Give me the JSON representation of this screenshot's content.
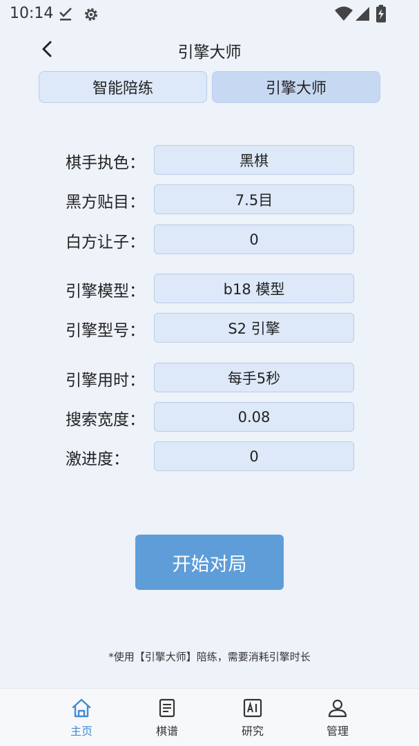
{
  "status_bar": {
    "time": "10:14",
    "icons": [
      "download-done-icon",
      "settings-icon",
      "wifi-icon",
      "cellular-signal-icon",
      "battery-charging-icon"
    ]
  },
  "header": {
    "title": "引擎大师",
    "back_icon": "back-arrow-icon"
  },
  "tabs": [
    {
      "label": "智能陪练"
    },
    {
      "label": "引擎大师",
      "selected": true
    }
  ],
  "form": {
    "rows": [
      {
        "label": "棋手执色：",
        "value": "黑棋"
      },
      {
        "label": "黑方贴目：",
        "value": "7.5目"
      },
      {
        "label": "白方让子：",
        "value": "0"
      },
      {
        "label": "引擎模型：",
        "value": "b18 模型"
      },
      {
        "label": "引擎型号：",
        "value": "S2 引擎"
      },
      {
        "label": "引擎用时：",
        "value": "每手5秒"
      },
      {
        "label": "搜索宽度：",
        "value": "0.08"
      },
      {
        "label": "激进度：",
        "value": "0"
      }
    ]
  },
  "start_button": {
    "label": "开始对局"
  },
  "note": "*使用【引擎大师】陪练，需要消耗引擎时长",
  "bottom_nav": {
    "items": [
      {
        "label": "主页",
        "icon": "home-icon",
        "active": true
      },
      {
        "label": "棋谱",
        "icon": "document-icon"
      },
      {
        "label": "研究",
        "icon": "ai-icon"
      },
      {
        "label": "管理",
        "icon": "profile-icon"
      }
    ]
  },
  "colors": {
    "background": "#eef2f9",
    "field_background": "#dde8f8",
    "field_border": "#b8cceb",
    "selected_tab": "#c7d8f3",
    "primary_button": "#5e9dd8",
    "active_nav": "#3f8ad8"
  }
}
